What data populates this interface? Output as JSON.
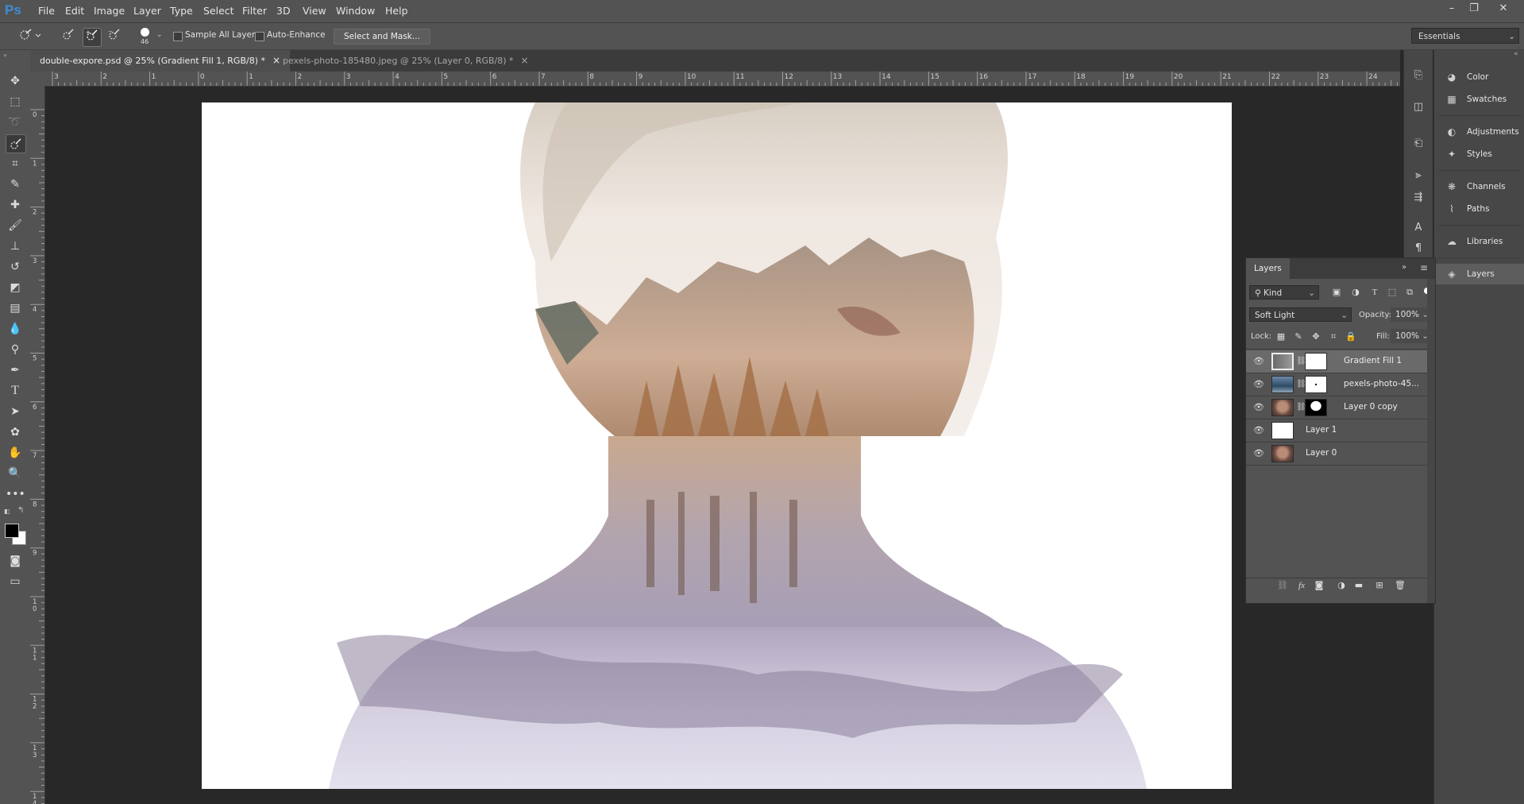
{
  "app": {
    "logo": "Ps"
  },
  "menu": [
    "File",
    "Edit",
    "Image",
    "Layer",
    "Type",
    "Select",
    "Filter",
    "3D",
    "View",
    "Window",
    "Help"
  ],
  "window_controls": {
    "minimize": "–",
    "restore": "❐",
    "close": "✕"
  },
  "options_bar": {
    "brush_size": "46",
    "sample_all_layers": "Sample All Layers",
    "auto_enhance": "Auto-Enhance",
    "select_and_mask": "Select and Mask...",
    "workspace": "Essentials"
  },
  "tabs": [
    {
      "label": "double-expore.psd @ 25% (Gradient Fill 1, RGB/8) *",
      "close": "×"
    },
    {
      "label": "pexels-photo-185480.jpeg @ 25% (Layer 0, RGB/8) *",
      "close": "×"
    }
  ],
  "ruler": {
    "h_numbers": [
      "3",
      "2",
      "1",
      "0",
      "1",
      "2",
      "3",
      "4",
      "5",
      "6",
      "7",
      "8",
      "9",
      "10",
      "11",
      "12",
      "13",
      "14",
      "15",
      "16",
      "17",
      "18",
      "19",
      "20",
      "21",
      "22",
      "23",
      "24"
    ],
    "v_numbers": [
      "0",
      "1",
      "2",
      "3",
      "4",
      "5",
      "6",
      "7",
      "8",
      "9",
      "1\n0",
      "1\n1",
      "1\n2",
      "1\n3",
      "1\n4"
    ]
  },
  "right_dock": {
    "items": [
      {
        "label": "Color",
        "icon": "color-wheel-icon"
      },
      {
        "label": "Swatches",
        "icon": "swatches-grid-icon"
      },
      {
        "label": "Adjustments",
        "icon": "adjustments-icon"
      },
      {
        "label": "Styles",
        "icon": "styles-fx-icon"
      },
      {
        "label": "Channels",
        "icon": "channels-icon"
      },
      {
        "label": "Paths",
        "icon": "paths-icon"
      },
      {
        "label": "Libraries",
        "icon": "libraries-cloud-icon"
      },
      {
        "label": "Layers",
        "icon": "layers-stack-icon"
      }
    ]
  },
  "layers_panel": {
    "title": "Layers",
    "filter_kind": "Kind",
    "blend_mode": "Soft Light",
    "opacity_label": "Opacity:",
    "opacity_value": "100%",
    "lock_label": "Lock:",
    "fill_label": "Fill:",
    "fill_value": "100%",
    "layers": [
      {
        "name": "Gradient Fill 1",
        "selected": true
      },
      {
        "name": "pexels-photo-45...",
        "selected": false
      },
      {
        "name": "Layer 0 copy",
        "selected": false
      },
      {
        "name": "Layer 1",
        "selected": false
      },
      {
        "name": "Layer 0",
        "selected": false
      }
    ]
  },
  "colors": {
    "ui_dark": "#535353",
    "canvas_bg": "#282828",
    "ps_blue": "#3b8ed8",
    "foreground": "#000000",
    "background": "#ffffff"
  }
}
